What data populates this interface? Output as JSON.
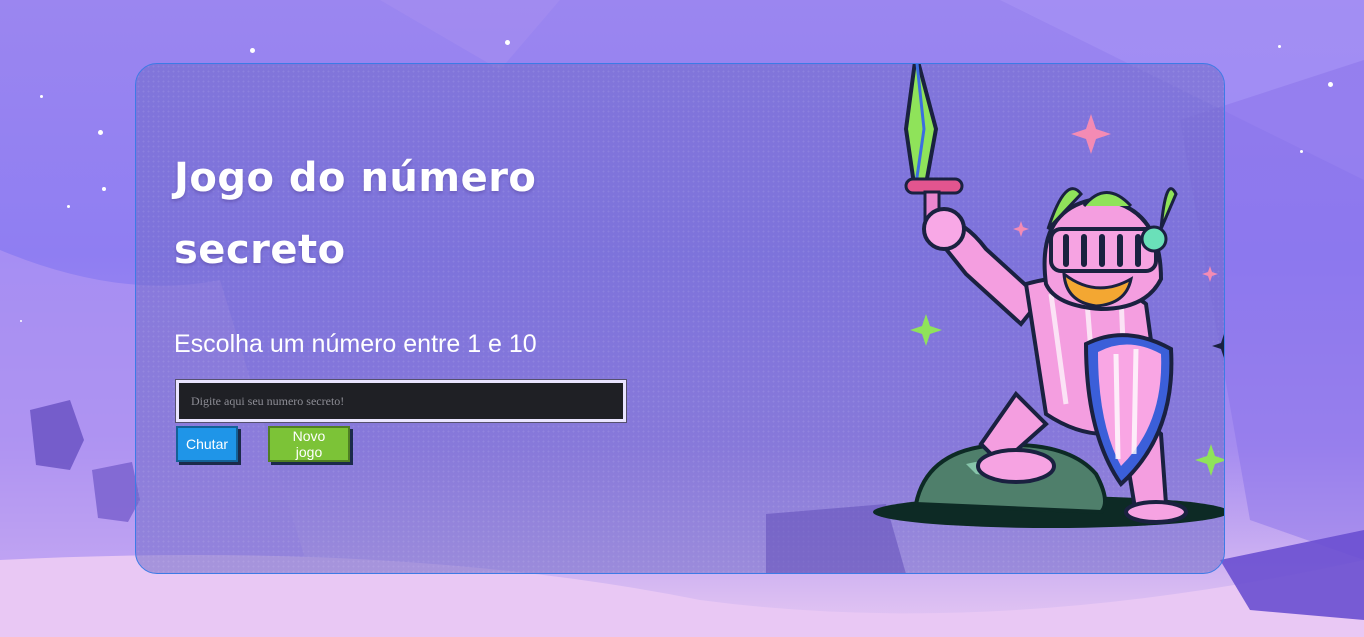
{
  "game": {
    "title": "Jogo do número secreto",
    "instruction": "Escolha um número entre 1 e 10",
    "input": {
      "placeholder": "Digite aqui seu numero secreto!",
      "value": ""
    },
    "buttons": {
      "kick_label": "Chutar",
      "new_game_label": "Novo jogo"
    }
  },
  "illustration": {
    "icon": "knight-illustration"
  },
  "colors": {
    "background": "#9b86f0",
    "card_border": "#3d7be6",
    "kick_button": "#1f95e8",
    "new_game_button": "#7cc337",
    "input_bg": "#1f2025"
  }
}
